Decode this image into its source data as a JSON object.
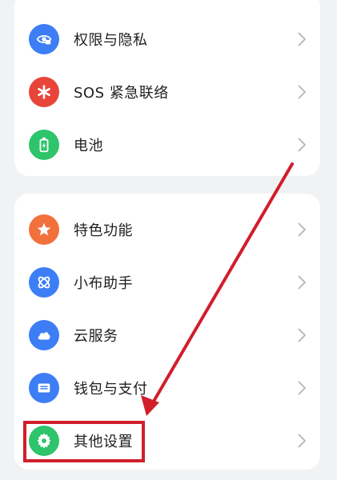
{
  "top_section": {
    "items": [
      {
        "label": "权限与隐私",
        "icon": "privacy-shield-icon",
        "icon_color": "#3d7ef7"
      },
      {
        "label": "SOS 紧急联络",
        "icon": "sos-asterisk-icon",
        "icon_color": "#e8443a"
      },
      {
        "label": "电池",
        "icon": "battery-icon",
        "icon_color": "#2ec46b"
      }
    ]
  },
  "bottom_section": {
    "items": [
      {
        "label": "特色功能",
        "icon": "star-icon",
        "icon_color": "#f2703c"
      },
      {
        "label": "小布助手",
        "icon": "assistant-icon",
        "icon_color": "#3d7ef7"
      },
      {
        "label": "云服务",
        "icon": "cloud-icon",
        "icon_color": "#3d7ef7"
      },
      {
        "label": "钱包与支付",
        "icon": "wallet-icon",
        "icon_color": "#3d7ef7"
      },
      {
        "label": "其他设置",
        "icon": "gear-icon",
        "icon_color": "#2ec46b"
      }
    ]
  },
  "colors": {
    "background": "#f1f2f4",
    "card": "#ffffff",
    "annotation": "#d11e2b",
    "chevron": "#b9bcc1"
  }
}
